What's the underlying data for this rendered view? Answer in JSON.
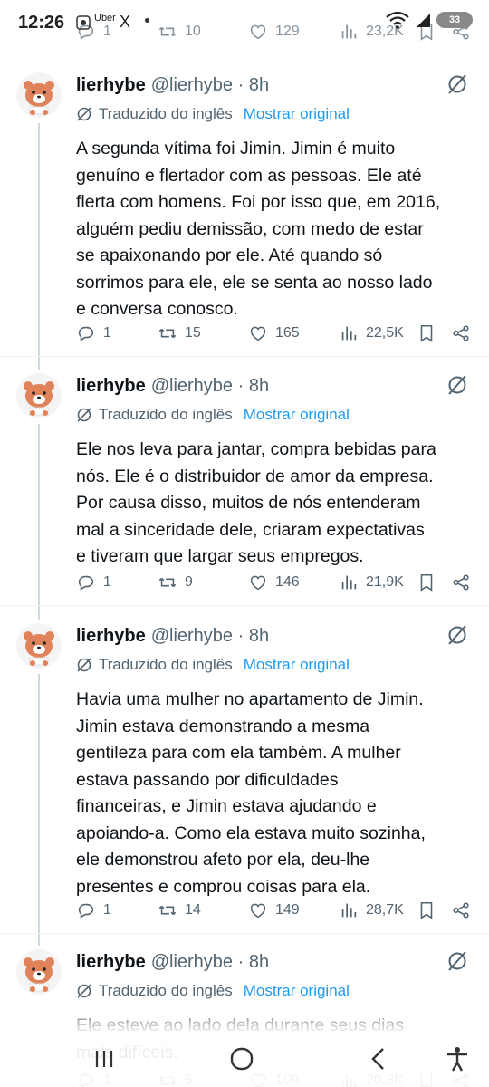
{
  "status_bar": {
    "time": "12:26",
    "app_label": "Uber",
    "x_label": "X",
    "battery": "33"
  },
  "previous_actions": {
    "replies": "1",
    "reposts": "10",
    "likes": "129",
    "views": "23,2K"
  },
  "tweets": [
    {
      "name": "lierhybe",
      "handle": "@lierhybe · 8h",
      "translated_label": "Traduzido do inglês",
      "show_original": "Mostrar original",
      "text": "A segunda vítima foi Jimin. Jimin é muito\ngenuíno e flertador com as pessoas. Ele até\nflerta com homens. Foi por isso que, em 2016,\nalguém pediu demissão, com medo de estar\nse apaixonando por ele. Até quando só\nsorrimos para ele, ele se senta ao nosso lado\ne conversa conosco.",
      "replies": "1",
      "reposts": "15",
      "likes": "165",
      "views": "22,5K"
    },
    {
      "name": "lierhybe",
      "handle": "@lierhybe · 8h",
      "translated_label": "Traduzido do inglês",
      "show_original": "Mostrar original",
      "text": "Ele nos leva para jantar, compra bebidas para\nnós. Ele é o distribuidor de amor da empresa.\nPor causa disso, muitos de nós entenderam\nmal a sinceridade dele, criaram expectativas\ne tiveram que largar seus empregos.",
      "replies": "1",
      "reposts": "9",
      "likes": "146",
      "views": "21,9K"
    },
    {
      "name": "lierhybe",
      "handle": "@lierhybe · 8h",
      "translated_label": "Traduzido do inglês",
      "show_original": "Mostrar original",
      "text": "Havia uma mulher no apartamento de Jimin.\nJimin estava demonstrando a mesma\ngentileza para com ela também. A mulher\nestava passando por dificuldades\nfinanceiras, e Jimin estava ajudando e\napoiando-a. Como ela estava muito sozinha,\nele demonstrou afeto por ela, deu-lhe\npresentes e comprou coisas para ela.",
      "replies": "1",
      "reposts": "14",
      "likes": "149",
      "views": "28,7K"
    },
    {
      "name": "lierhybe",
      "handle": "@lierhybe · 8h",
      "translated_label": "Traduzido do inglês",
      "show_original": "Mostrar original",
      "text": "Ele esteve ao lado dela durante seus dias\nmais difíceis.",
      "replies": "1",
      "reposts": "5",
      "likes": "109",
      "views": "20,8K"
    }
  ],
  "colors": {
    "link": "#1d9bf0",
    "muted": "#536471",
    "text": "#0f1419",
    "avatar_bear": "#e0835a"
  }
}
